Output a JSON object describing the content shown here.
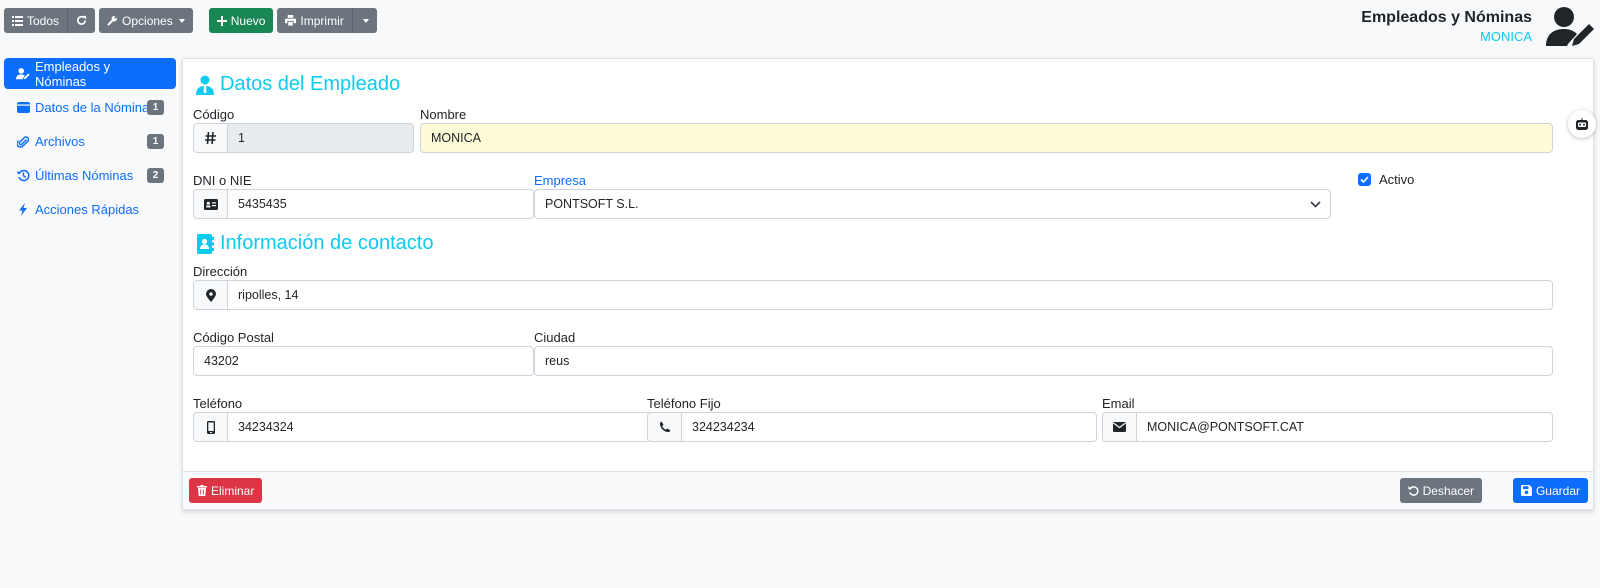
{
  "toolbar": {
    "todos_label": "Todos",
    "opciones_label": "Opciones",
    "nuevo_label": "Nuevo",
    "imprimir_label": "Imprimir"
  },
  "header": {
    "title": "Empleados y Nóminas",
    "user": "MONICA",
    "avatar_icon": "user-edit-icon"
  },
  "sidebar": {
    "items": [
      {
        "label": "Empleados y Nóminas",
        "icon": "user-edit-icon",
        "badge": ""
      },
      {
        "label": "Datos de la Nómina",
        "icon": "wallet-icon",
        "badge": "1"
      },
      {
        "label": "Archivos",
        "icon": "paperclip-icon",
        "badge": "1"
      },
      {
        "label": "Últimas Nóminas",
        "icon": "history-icon",
        "badge": "2"
      },
      {
        "label": "Acciones Rápidas",
        "icon": "bolt-icon",
        "badge": ""
      }
    ]
  },
  "employee_section": {
    "title": "Datos del Empleado",
    "codigo_label": "Código",
    "codigo_value": "1",
    "nombre_label": "Nombre",
    "nombre_value": "MONICA",
    "dni_label": "DNI o NIE",
    "dni_value": "5435435",
    "empresa_label": "Empresa",
    "empresa_value": "PONTSOFT S.L.",
    "activo_label": "Activo",
    "activo_checked": true
  },
  "contact_section": {
    "title": "Información de contacto",
    "direccion_label": "Dirección",
    "direccion_value": "ripolles, 14",
    "cp_label": "Código Postal",
    "cp_value": "43202",
    "ciudad_label": "Ciudad",
    "ciudad_value": "reus",
    "telefono_label": "Teléfono",
    "telefono_value": "34234324",
    "fijo_label": "Teléfono Fijo",
    "fijo_value": "324234234",
    "email_label": "Email",
    "email_value": "MONICA@PONTSOFT.CAT"
  },
  "footer": {
    "eliminar_label": "Eliminar",
    "deshacer_label": "Deshacer",
    "guardar_label": "Guardar"
  },
  "colors": {
    "primary": "#0d6efd",
    "info": "#0dcaf0",
    "success": "#198754",
    "danger": "#dc3545",
    "secondary": "#6c757d",
    "highlight": "#fefcd8"
  }
}
